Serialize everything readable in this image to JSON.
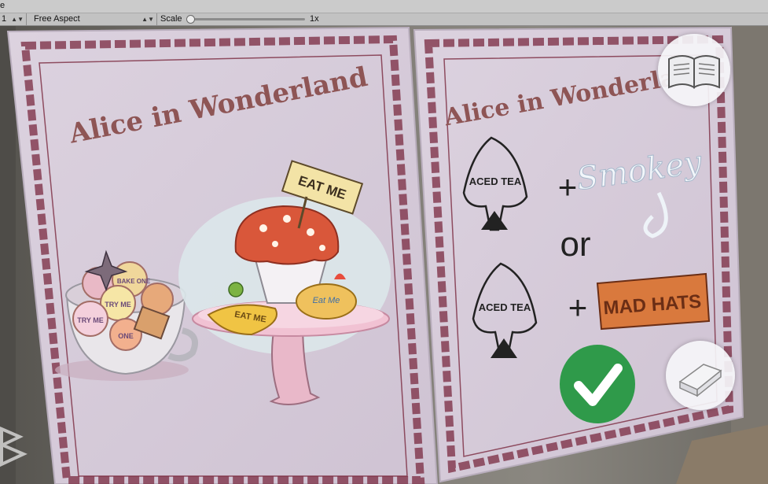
{
  "toolbar": {
    "tab_label": "e",
    "display_value": "1",
    "aspect_value": "Free Aspect",
    "scale_label": "Scale",
    "scale_value": "1x"
  },
  "left_card": {
    "title": "Alice in Wonderland",
    "cookie_labels": [
      "TRY ME",
      "BAKE ONE",
      "TRY ME",
      "ONE"
    ],
    "sign_text": "EAT ME",
    "banana_text": "EAT ME",
    "cookie_text": "Eat Me"
  },
  "right_card": {
    "title": "Alice in Wonderland",
    "logo_text": "ACED TEA",
    "smokey_text": "Smokey",
    "plus": "+",
    "or_text": "or",
    "madhats_text": "MAD HATS"
  },
  "buttons": {
    "book_icon": "open-book-icon",
    "closed_book_icon": "closed-book-icon",
    "check_icon": "checkmark-icon"
  },
  "colors": {
    "card_bg": "#d6cbd9",
    "border": "#7a2a40",
    "title": "#8e5555",
    "check_green": "#2f9a4a",
    "madhats_orange": "#d9793d"
  }
}
